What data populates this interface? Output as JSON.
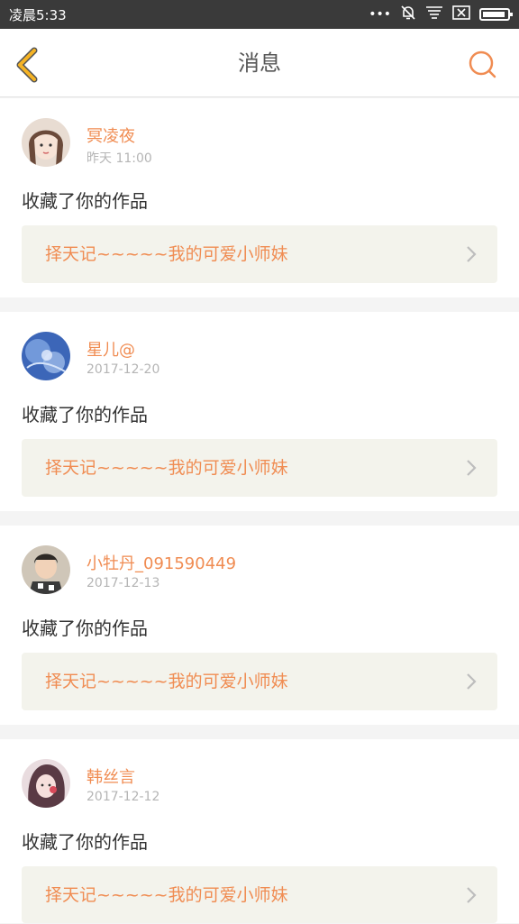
{
  "status_bar": {
    "time": "凌晨5:33",
    "dots": "•••"
  },
  "nav": {
    "title": "消息"
  },
  "messages": [
    {
      "username": "冥凌夜",
      "time": "昨天 11:00",
      "action": "收藏了你的作品",
      "work_title": "择天记~~~~~我的可爱小师妹"
    },
    {
      "username": "星儿@",
      "time": "2017-12-20",
      "action": "收藏了你的作品",
      "work_title": "择天记~~~~~我的可爱小师妹"
    },
    {
      "username": "小牡丹_091590449",
      "time": "2017-12-13",
      "action": "收藏了你的作品",
      "work_title": "择天记~~~~~我的可爱小师妹"
    },
    {
      "username": "韩丝言",
      "time": "2017-12-12",
      "action": "收藏了你的作品",
      "work_title": "择天记~~~~~我的可爱小师妹"
    }
  ],
  "colors": {
    "accent": "#f08c52",
    "back_icon": "#f5b324",
    "status_bar_bg": "#3a3a3a",
    "link_bg": "#f3f3ec"
  },
  "icons": [
    "back-arrow-icon",
    "search-icon",
    "mute-bell-icon",
    "notification-icon",
    "close-box-icon",
    "battery-icon",
    "chevron-right-icon"
  ]
}
